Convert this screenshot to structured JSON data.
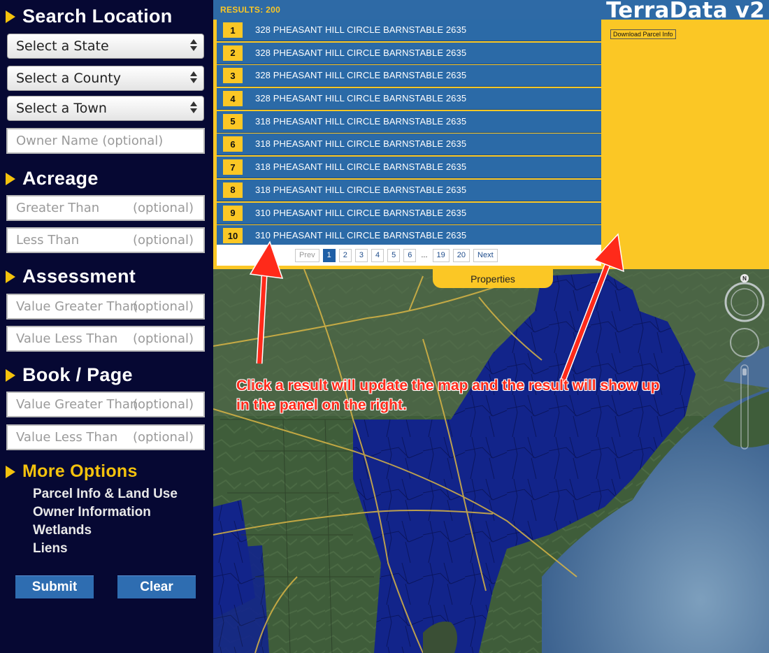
{
  "app": {
    "title": "TerraData v2"
  },
  "sidebar": {
    "search_location_title": "Search Location",
    "state_select": "Select a State",
    "county_select": "Select a County",
    "town_select": "Select a Town",
    "owner_placeholder": "Owner Name (optional)",
    "acreage_title": "Acreage",
    "acreage_greater": "Greater Than",
    "acreage_less": "Less Than",
    "optional": "(optional)",
    "assessment_title": "Assessment",
    "assess_greater": "Value Greater Than",
    "assess_less": "Value Less Than",
    "book_page_title": "Book / Page",
    "book_greater": "Value Greater Than",
    "book_less": "Value Less Than",
    "more_options_title": "More Options",
    "more_options": [
      "Parcel Info & Land Use",
      "Owner Information",
      "Wetlands",
      "Liens"
    ],
    "submit": "Submit",
    "clear": "Clear"
  },
  "results": {
    "count_label": "RESULTS: 200",
    "items": [
      {
        "num": "1",
        "address": "328 PHEASANT HILL CIRCLE BARNSTABLE 2635"
      },
      {
        "num": "2",
        "address": "328 PHEASANT HILL CIRCLE BARNSTABLE 2635"
      },
      {
        "num": "3",
        "address": "328 PHEASANT HILL CIRCLE BARNSTABLE 2635"
      },
      {
        "num": "4",
        "address": "328 PHEASANT HILL CIRCLE BARNSTABLE 2635"
      },
      {
        "num": "5",
        "address": "318 PHEASANT HILL CIRCLE BARNSTABLE 2635"
      },
      {
        "num": "6",
        "address": "318 PHEASANT HILL CIRCLE BARNSTABLE 2635"
      },
      {
        "num": "7",
        "address": "318 PHEASANT HILL CIRCLE BARNSTABLE 2635"
      },
      {
        "num": "8",
        "address": "318 PHEASANT HILL CIRCLE BARNSTABLE 2635"
      },
      {
        "num": "9",
        "address": "310 PHEASANT HILL CIRCLE BARNSTABLE 2635"
      },
      {
        "num": "10",
        "address": "310 PHEASANT HILL CIRCLE BARNSTABLE 2635"
      }
    ],
    "pagination": {
      "prev": "Prev",
      "pages": [
        "1",
        "2",
        "3",
        "4",
        "5",
        "6"
      ],
      "ellipsis": "...",
      "tail": [
        "19",
        "20"
      ],
      "next": "Next",
      "current": "1"
    }
  },
  "detail_panel": {
    "download_label": "Download Parcel Info"
  },
  "properties_tab": "Properties",
  "map": {
    "compass_label": "N"
  },
  "annotation": {
    "text_line1": "Click a result will update the map and the result will show up",
    "text_line2": "in the panel on the right."
  },
  "colors": {
    "sidebar_bg": "#060833",
    "accent_yellow": "#fbc725",
    "result_blue": "#2b6aa7",
    "annotation_red": "#ff2a1a"
  }
}
